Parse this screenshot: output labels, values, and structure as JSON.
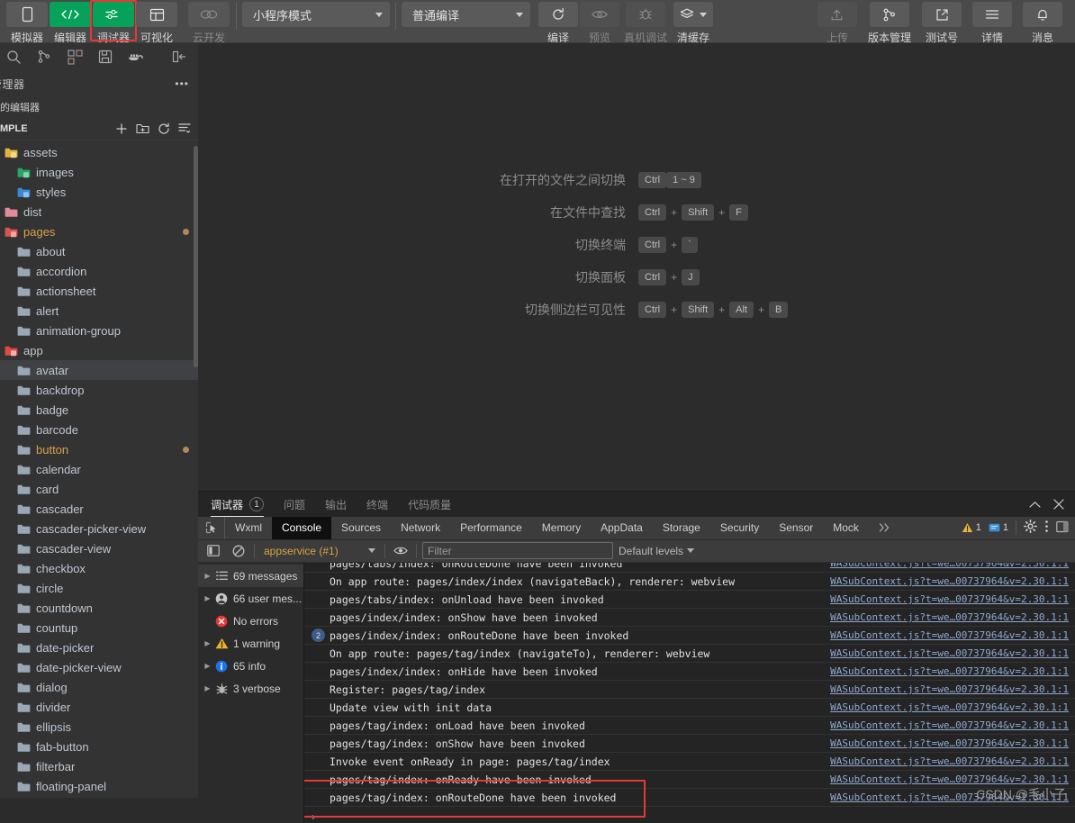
{
  "toolbar": {
    "left_tabs": [
      {
        "label": "模拟器",
        "icon": "phone-icon",
        "state": "normal"
      },
      {
        "label": "编辑器",
        "icon": "code-icon",
        "state": "green"
      },
      {
        "label": "调试器",
        "icon": "sliders-icon",
        "state": "green-selected"
      },
      {
        "label": "可视化",
        "icon": "layout-icon",
        "state": "normal"
      },
      {
        "label": "云开发",
        "icon": "cloud-icon",
        "state": "disabled"
      }
    ],
    "mode_select": "小程序模式",
    "compile_select": "普通编译",
    "actions": [
      {
        "label": "编译",
        "icon": "refresh-icon",
        "state": "normal"
      },
      {
        "label": "预览",
        "icon": "eye-icon",
        "state": "disabled"
      },
      {
        "label": "真机调试",
        "icon": "bug-icon",
        "state": "disabled"
      },
      {
        "label": "清缓存",
        "icon": "layers-icon",
        "state": "normal"
      }
    ],
    "right_actions": [
      {
        "label": "上传",
        "icon": "upload-icon",
        "state": "disabled"
      },
      {
        "label": "版本管理",
        "icon": "branch-icon",
        "state": "normal"
      },
      {
        "label": "测试号",
        "icon": "external-link-icon",
        "state": "normal"
      },
      {
        "label": "详情",
        "icon": "menu-icon",
        "state": "normal"
      },
      {
        "label": "消息",
        "icon": "bell-icon",
        "state": "normal"
      }
    ]
  },
  "sidebar": {
    "activity_icons": [
      "search-icon",
      "source-control-icon",
      "extensions-icon",
      "save-all-icon",
      "docker-icon",
      "collapse-panel-icon"
    ],
    "panel_title": "管理器",
    "open_editors_label": "的编辑器",
    "project_name": "MPLE",
    "section_actions": [
      "new-file-icon",
      "new-folder-icon",
      "refresh-icon",
      "collapse-all-icon"
    ],
    "tree": [
      {
        "label": "assets",
        "icon": "folder-yellow",
        "indent": 0,
        "selected": false,
        "modified": false,
        "dot": false
      },
      {
        "label": "images",
        "icon": "folder-green-img",
        "indent": 1,
        "selected": false,
        "modified": false,
        "dot": false
      },
      {
        "label": "styles",
        "icon": "folder-blue-css",
        "indent": 1,
        "selected": false,
        "modified": false,
        "dot": false
      },
      {
        "label": "dist",
        "icon": "folder-pink",
        "indent": 0,
        "selected": false,
        "modified": false,
        "dot": false
      },
      {
        "label": "pages",
        "icon": "folder-red-pages",
        "indent": 0,
        "selected": false,
        "modified": true,
        "dot": true
      },
      {
        "label": "about",
        "icon": "folder-plain",
        "indent": 1,
        "selected": false,
        "modified": false,
        "dot": false
      },
      {
        "label": "accordion",
        "icon": "folder-plain",
        "indent": 1,
        "selected": false,
        "modified": false,
        "dot": false
      },
      {
        "label": "actionsheet",
        "icon": "folder-plain",
        "indent": 1,
        "selected": false,
        "modified": false,
        "dot": false
      },
      {
        "label": "alert",
        "icon": "folder-plain",
        "indent": 1,
        "selected": false,
        "modified": false,
        "dot": false
      },
      {
        "label": "animation-group",
        "icon": "folder-plain",
        "indent": 1,
        "selected": false,
        "modified": false,
        "dot": false
      },
      {
        "label": "app",
        "icon": "folder-red-grid",
        "indent": 0,
        "selected": false,
        "modified": false,
        "dot": false
      },
      {
        "label": "avatar",
        "icon": "folder-plain",
        "indent": 1,
        "selected": true,
        "modified": false,
        "dot": false
      },
      {
        "label": "backdrop",
        "icon": "folder-plain",
        "indent": 1,
        "selected": false,
        "modified": false,
        "dot": false
      },
      {
        "label": "badge",
        "icon": "folder-plain",
        "indent": 1,
        "selected": false,
        "modified": false,
        "dot": false
      },
      {
        "label": "barcode",
        "icon": "folder-plain",
        "indent": 1,
        "selected": false,
        "modified": false,
        "dot": false
      },
      {
        "label": "button",
        "icon": "folder-plain",
        "indent": 1,
        "selected": false,
        "modified": true,
        "dot": true
      },
      {
        "label": "calendar",
        "icon": "folder-plain",
        "indent": 1,
        "selected": false,
        "modified": false,
        "dot": false
      },
      {
        "label": "card",
        "icon": "folder-plain",
        "indent": 1,
        "selected": false,
        "modified": false,
        "dot": false
      },
      {
        "label": "cascader",
        "icon": "folder-plain",
        "indent": 1,
        "selected": false,
        "modified": false,
        "dot": false
      },
      {
        "label": "cascader-picker-view",
        "icon": "folder-plain",
        "indent": 1,
        "selected": false,
        "modified": false,
        "dot": false
      },
      {
        "label": "cascader-view",
        "icon": "folder-plain",
        "indent": 1,
        "selected": false,
        "modified": false,
        "dot": false
      },
      {
        "label": "checkbox",
        "icon": "folder-plain",
        "indent": 1,
        "selected": false,
        "modified": false,
        "dot": false
      },
      {
        "label": "circle",
        "icon": "folder-plain",
        "indent": 1,
        "selected": false,
        "modified": false,
        "dot": false
      },
      {
        "label": "countdown",
        "icon": "folder-plain",
        "indent": 1,
        "selected": false,
        "modified": false,
        "dot": false
      },
      {
        "label": "countup",
        "icon": "folder-plain",
        "indent": 1,
        "selected": false,
        "modified": false,
        "dot": false
      },
      {
        "label": "date-picker",
        "icon": "folder-plain",
        "indent": 1,
        "selected": false,
        "modified": false,
        "dot": false
      },
      {
        "label": "date-picker-view",
        "icon": "folder-plain",
        "indent": 1,
        "selected": false,
        "modified": false,
        "dot": false
      },
      {
        "label": "dialog",
        "icon": "folder-plain",
        "indent": 1,
        "selected": false,
        "modified": false,
        "dot": false
      },
      {
        "label": "divider",
        "icon": "folder-plain",
        "indent": 1,
        "selected": false,
        "modified": false,
        "dot": false
      },
      {
        "label": "ellipsis",
        "icon": "folder-plain",
        "indent": 1,
        "selected": false,
        "modified": false,
        "dot": false
      },
      {
        "label": "fab-button",
        "icon": "folder-plain",
        "indent": 1,
        "selected": false,
        "modified": false,
        "dot": false
      },
      {
        "label": "filterbar",
        "icon": "folder-plain",
        "indent": 1,
        "selected": false,
        "modified": false,
        "dot": false
      },
      {
        "label": "floating-panel",
        "icon": "folder-plain",
        "indent": 1,
        "selected": false,
        "modified": false,
        "dot": false
      }
    ]
  },
  "welcome": {
    "shortcuts": [
      {
        "desc": "在打开的文件之间切换",
        "keys": [
          "Ctrl",
          "1 ~ 9"
        ],
        "seps": [
          ""
        ]
      },
      {
        "desc": "在文件中查找",
        "keys": [
          "Ctrl",
          "Shift",
          "F"
        ],
        "seps": [
          "+",
          "+"
        ]
      },
      {
        "desc": "切换终端",
        "keys": [
          "Ctrl",
          "`"
        ],
        "seps": [
          "+"
        ]
      },
      {
        "desc": "切换面板",
        "keys": [
          "Ctrl",
          "J"
        ],
        "seps": [
          "+"
        ]
      },
      {
        "desc": "切换侧边栏可见性",
        "keys": [
          "Ctrl",
          "Shift",
          "Alt",
          "B"
        ],
        "seps": [
          "+",
          "+",
          "+"
        ]
      }
    ]
  },
  "devpanel": {
    "tabs": [
      {
        "label": "调试器",
        "badge": "1",
        "active": true
      },
      {
        "label": "问题",
        "badge": "",
        "active": false
      },
      {
        "label": "输出",
        "badge": "",
        "active": false
      },
      {
        "label": "终端",
        "badge": "",
        "active": false
      },
      {
        "label": "代码质量",
        "badge": "",
        "active": false
      }
    ],
    "panel_controls": [
      "chevron-up-icon",
      "close-icon"
    ],
    "devtools_tabs": [
      {
        "label": "Wxml",
        "active": false
      },
      {
        "label": "Console",
        "active": true
      },
      {
        "label": "Sources",
        "active": false
      },
      {
        "label": "Network",
        "active": false
      },
      {
        "label": "Performance",
        "active": false
      },
      {
        "label": "Memory",
        "active": false
      },
      {
        "label": "AppData",
        "active": false
      },
      {
        "label": "Storage",
        "active": false
      },
      {
        "label": "Security",
        "active": false
      },
      {
        "label": "Sensor",
        "active": false
      },
      {
        "label": "Mock",
        "active": false
      }
    ],
    "more_tabs_icon": "chevron-double-right-icon",
    "warning_count": "1",
    "message_count": "1",
    "console": {
      "context": "appservice (#1)",
      "filter_placeholder": "Filter",
      "filter_value": "",
      "levels_label": "Default levels",
      "sidebar": [
        {
          "label": "69 messages",
          "icon": "list-icon",
          "expandable": true,
          "selected": true
        },
        {
          "label": "66 user mes...",
          "icon": "user-icon",
          "expandable": true,
          "selected": false
        },
        {
          "label": "No errors",
          "icon": "error-icon",
          "expandable": false,
          "selected": false
        },
        {
          "label": "1 warning",
          "icon": "warning-icon",
          "expandable": true,
          "selected": false
        },
        {
          "label": "65 info",
          "icon": "info-icon",
          "expandable": true,
          "selected": false
        },
        {
          "label": "3 verbose",
          "icon": "bug-icon",
          "expandable": true,
          "selected": false
        }
      ],
      "source_link": "WASubContext.js?t=we…00737964&v=2.30.1:1",
      "logs": [
        {
          "text": "pages/tabs/index: onRouteDone have been invoked",
          "count": "",
          "partial": true
        },
        {
          "text": "On app route: pages/index/index (navigateBack), renderer: webview",
          "count": ""
        },
        {
          "text": "pages/tabs/index: onUnload have been invoked",
          "count": ""
        },
        {
          "text": "pages/index/index: onShow have been invoked",
          "count": ""
        },
        {
          "text": "pages/index/index: onRouteDone have been invoked",
          "count": "2"
        },
        {
          "text": "On app route: pages/tag/index (navigateTo), renderer: webview",
          "count": ""
        },
        {
          "text": "pages/index/index: onHide have been invoked",
          "count": ""
        },
        {
          "text": "Register: pages/tag/index",
          "count": ""
        },
        {
          "text": "Update view with init data",
          "count": ""
        },
        {
          "text": "pages/tag/index: onLoad have been invoked",
          "count": ""
        },
        {
          "text": "pages/tag/index: onShow have been invoked",
          "count": ""
        },
        {
          "text": "Invoke event onReady in page: pages/tag/index",
          "count": ""
        },
        {
          "text": "pages/tag/index: onReady have been invoked",
          "count": ""
        },
        {
          "text": "pages/tag/index: onRouteDone have been invoked",
          "count": ""
        }
      ],
      "prompt": "›"
    }
  },
  "watermark": "CSDN @毛小子",
  "colors": {
    "accent_green": "#07a25a",
    "highlight_red": "#e53935",
    "modified_orange": "#d6a14d",
    "link_blue": "#8ea8d0",
    "context_orange": "#d9a441"
  }
}
